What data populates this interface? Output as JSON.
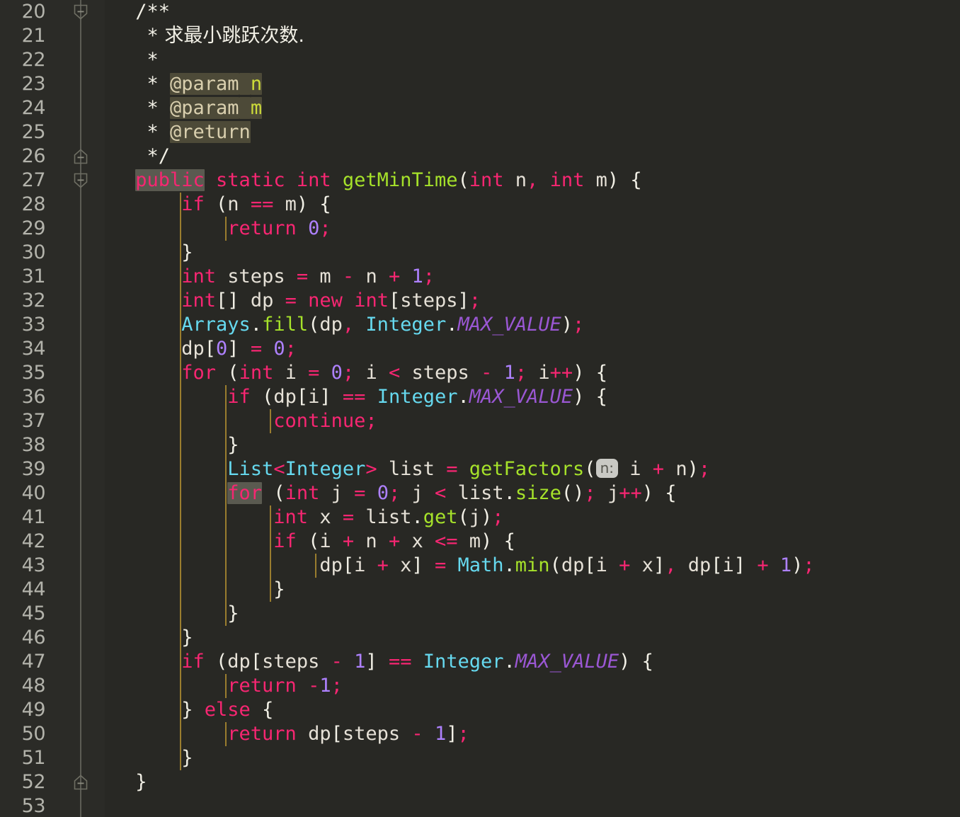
{
  "editor": {
    "language": "java",
    "background_color": "#282824",
    "gutter_color": "#2b2b27",
    "first_line": 20,
    "last_line": 53,
    "line_height_px": 34,
    "font_size_px": 27
  },
  "colors": {
    "keyword": "#f72672",
    "method": "#a6e22a",
    "class_type": "#66d9ef",
    "number": "#ae81ff",
    "plain_text": "#e6e1d7",
    "comment": "#f2f0e6",
    "javadoc_tag": "#d9cfae",
    "javadoc_param": "#cddc39",
    "static_field": "#9a57d3",
    "indent_guide": "#9a7d2e",
    "line_number": "#b3b3ab",
    "identifier_highlight_bg": "#5a5a50",
    "javadoc_highlight_bg": "#4d4a38",
    "param_hint_bg": "#c9c9c4"
  },
  "line_numbers": [
    20,
    21,
    22,
    23,
    24,
    25,
    26,
    27,
    28,
    29,
    30,
    31,
    32,
    33,
    34,
    35,
    36,
    37,
    38,
    39,
    40,
    41,
    42,
    43,
    44,
    45,
    46,
    47,
    48,
    49,
    50,
    51,
    52,
    53
  ],
  "fold_markers": [
    {
      "line": 20,
      "type": "collapse-down",
      "icon": "fold-minus-down-icon"
    },
    {
      "line": 26,
      "type": "collapse-up",
      "icon": "fold-minus-up-icon"
    },
    {
      "line": 27,
      "type": "collapse-down",
      "icon": "fold-minus-down-icon"
    },
    {
      "line": 52,
      "type": "collapse-up",
      "icon": "fold-minus-up-icon"
    }
  ],
  "code_lines": [
    {
      "n": 20,
      "text": "    /**"
    },
    {
      "n": 21,
      "text": "     * 求最小跳跃次数."
    },
    {
      "n": 22,
      "text": "     *"
    },
    {
      "n": 23,
      "text": "     * @param n"
    },
    {
      "n": 24,
      "text": "     * @param m"
    },
    {
      "n": 25,
      "text": "     * @return"
    },
    {
      "n": 26,
      "text": "     */"
    },
    {
      "n": 27,
      "text": "    public static int getMinTime(int n, int m) {"
    },
    {
      "n": 28,
      "text": "        if (n == m) {"
    },
    {
      "n": 29,
      "text": "            return 0;"
    },
    {
      "n": 30,
      "text": "        }"
    },
    {
      "n": 31,
      "text": "        int steps = m - n + 1;"
    },
    {
      "n": 32,
      "text": "        int[] dp = new int[steps];"
    },
    {
      "n": 33,
      "text": "        Arrays.fill(dp, Integer.MAX_VALUE);"
    },
    {
      "n": 34,
      "text": "        dp[0] = 0;"
    },
    {
      "n": 35,
      "text": "        for (int i = 0; i < steps - 1; i++) {"
    },
    {
      "n": 36,
      "text": "            if (dp[i] == Integer.MAX_VALUE) {"
    },
    {
      "n": 37,
      "text": "                continue;"
    },
    {
      "n": 38,
      "text": "            }"
    },
    {
      "n": 39,
      "text": "            List<Integer> list = getFactors( n: i + n);"
    },
    {
      "n": 40,
      "text": "            for (int j = 0; j < list.size(); j++) {"
    },
    {
      "n": 41,
      "text": "                int x = list.get(j);"
    },
    {
      "n": 42,
      "text": "                if (i + n + x <= m) {"
    },
    {
      "n": 43,
      "text": "                    dp[i + x] = Math.min(dp[i + x], dp[i] + 1);"
    },
    {
      "n": 44,
      "text": "                }"
    },
    {
      "n": 45,
      "text": "            }"
    },
    {
      "n": 46,
      "text": "        }"
    },
    {
      "n": 47,
      "text": "        if (dp[steps - 1] == Integer.MAX_VALUE) {"
    },
    {
      "n": 48,
      "text": "            return -1;"
    },
    {
      "n": 49,
      "text": "        } else {"
    },
    {
      "n": 50,
      "text": "            return dp[steps - 1];"
    },
    {
      "n": 51,
      "text": "        }"
    },
    {
      "n": 52,
      "text": "    }"
    },
    {
      "n": 53,
      "text": ""
    }
  ],
  "inlay_hints": [
    {
      "line": 39,
      "label": "n:",
      "for_call": "getFactors"
    }
  ],
  "highlighted_tokens": [
    {
      "line": 23,
      "token": "@param",
      "style": "javadoc-tag-highlight"
    },
    {
      "line": 24,
      "token": "@param",
      "style": "javadoc-tag-highlight"
    },
    {
      "line": 25,
      "token": "@return",
      "style": "javadoc-tag-highlight"
    },
    {
      "line": 27,
      "token": "public",
      "style": "identifier-highlight"
    },
    {
      "line": 40,
      "token": "for",
      "style": "identifier-highlight"
    }
  ],
  "javadoc": {
    "summary": "求最小跳跃次数.",
    "params": [
      "n",
      "m"
    ],
    "returns": ""
  },
  "method": {
    "name": "getMinTime",
    "modifiers": "public static",
    "return_type": "int",
    "parameters": "int n, int m"
  }
}
